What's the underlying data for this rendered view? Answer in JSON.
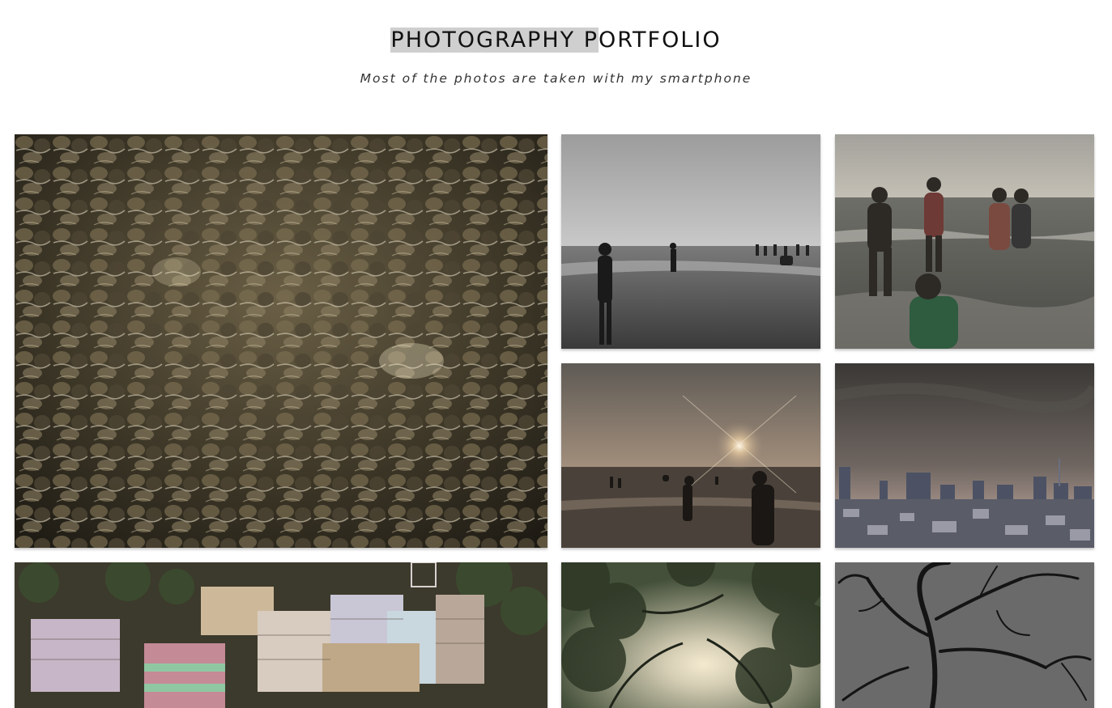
{
  "header": {
    "title_selected": "PHOTOGRAPHY P",
    "title_rest": "ORTFOLIO",
    "subtitle": "Most of the photos are taken with my smartphone"
  },
  "gallery": {
    "photos": [
      {
        "subject": "water-over-pebbles"
      },
      {
        "subject": "beach-bw-people"
      },
      {
        "subject": "boys-in-waves"
      },
      {
        "subject": "sunset-beach-silhouettes"
      },
      {
        "subject": "city-skyline-dusk"
      },
      {
        "subject": "colorful-city-buildings"
      },
      {
        "subject": "sun-through-trees"
      },
      {
        "subject": "bare-branches-bw"
      }
    ]
  }
}
